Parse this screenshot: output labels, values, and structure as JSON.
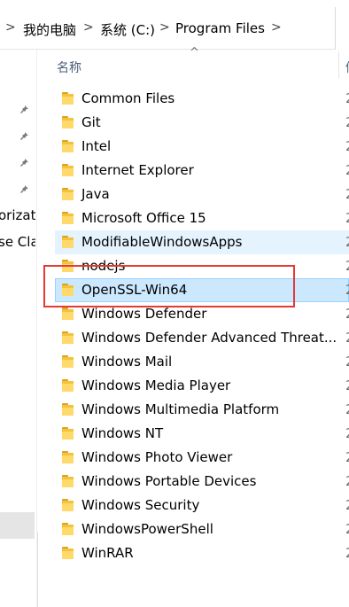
{
  "breadcrumb": {
    "items": [
      "我的电脑",
      "系统 (C:)",
      "Program Files"
    ],
    "separator": ">"
  },
  "nav": {
    "partial_items": [
      "orizati",
      "se Cla"
    ]
  },
  "header": {
    "name_column": "名称",
    "next_column_partial": "修",
    "sort_indicator": "^"
  },
  "files": [
    {
      "name": "Common Files",
      "date": "2",
      "state": "normal"
    },
    {
      "name": "Git",
      "date": "2",
      "state": "normal"
    },
    {
      "name": "Intel",
      "date": "2",
      "state": "normal"
    },
    {
      "name": "Internet Explorer",
      "date": "2",
      "state": "normal"
    },
    {
      "name": "Java",
      "date": "2",
      "state": "normal"
    },
    {
      "name": "Microsoft Office 15",
      "date": "2",
      "state": "normal"
    },
    {
      "name": "ModifiableWindowsApps",
      "date": "2",
      "state": "hover"
    },
    {
      "name": "nodejs",
      "date": "2",
      "state": "normal"
    },
    {
      "name": "OpenSSL-Win64",
      "date": "2",
      "state": "selected"
    },
    {
      "name": "Windows Defender",
      "date": "2",
      "state": "normal"
    },
    {
      "name": "Windows Defender Advanced Threat...",
      "date": "2",
      "state": "normal"
    },
    {
      "name": "Windows Mail",
      "date": "2",
      "state": "normal"
    },
    {
      "name": "Windows Media Player",
      "date": "2",
      "state": "normal"
    },
    {
      "name": "Windows Multimedia Platform",
      "date": "2",
      "state": "normal"
    },
    {
      "name": "Windows NT",
      "date": "2",
      "state": "normal"
    },
    {
      "name": "Windows Photo Viewer",
      "date": "2",
      "state": "normal"
    },
    {
      "name": "Windows Portable Devices",
      "date": "2",
      "state": "normal"
    },
    {
      "name": "Windows Security",
      "date": "2",
      "state": "normal"
    },
    {
      "name": "WindowsPowerShell",
      "date": "2",
      "state": "normal"
    },
    {
      "name": "WinRAR",
      "date": "2",
      "state": "normal"
    }
  ],
  "colors": {
    "selection_bg": "#cce8ff",
    "hover_bg": "#e5f3ff",
    "annotation": "#e53935",
    "folder": "#f4c23b"
  }
}
